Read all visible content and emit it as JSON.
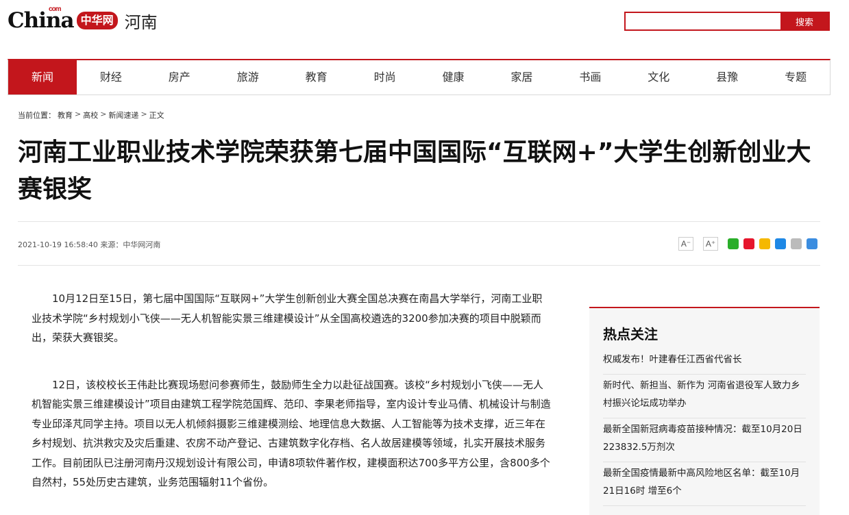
{
  "header": {
    "logo_text": "China",
    "logo_com": "com",
    "logo_zh": "中华网",
    "region": "河南",
    "search_placeholder": "",
    "search_button": "搜索"
  },
  "nav": [
    "新闻",
    "财经",
    "房产",
    "旅游",
    "教育",
    "时尚",
    "健康",
    "家居",
    "书画",
    "文化",
    "县豫",
    "专题"
  ],
  "breadcrumb": {
    "prefix": "当前位置：",
    "items": [
      "教育",
      "高校",
      "新闻速递",
      "正文"
    ],
    "separator": ">"
  },
  "article": {
    "title": "河南工业职业技术学院荣获第七届中国国际“互联网+”大学生创新创业大赛银奖",
    "meta": "2021-10-19 16:58:40 来源：中华网河南",
    "paragraphs": [
      "10月12日至15日，第七届中国国际“互联网+”大学生创新创业大赛全国总决赛在南昌大学举行，河南工业职业技术学院“乡村规划小飞侠——无人机智能实景三维建模设计”从全国高校遴选的3200参加决赛的项目中脱颖而出，荣获大赛银奖。",
      "12日，该校校长王伟赴比赛现场慰问参赛师生，鼓励师生全力以赴征战国赛。该校“乡村规划小飞侠——无人机智能实景三维建模设计”项目由建筑工程学院范国辉、范印、李果老师指导，室内设计专业马倩、机械设计与制造专业邱泽芃同学主持。项目以无人机倾斜摄影三维建模测绘、地理信息大数据、人工智能等为技术支撑，近三年在乡村规划、抗洪救灾及灾后重建、农房不动产登记、古建筑数字化存档、名人故居建模等领域，扎实开展技术服务工作。目前团队已注册河南丹汉规划设计有限公司，申请8项软件著作权，建模面积达700多平方公里，含800多个自然村，55处历史古建筑，业务范围辐射11个省份。"
    ]
  },
  "tools": {
    "font_smaller": "A⁻",
    "font_larger": "A⁺",
    "share_icons": [
      {
        "name": "wechat-icon",
        "color": "#2aae2a"
      },
      {
        "name": "weibo-icon",
        "color": "#e6162d"
      },
      {
        "name": "qzone-icon",
        "color": "#f5b800"
      },
      {
        "name": "qq-icon",
        "color": "#1e88e5"
      },
      {
        "name": "copy-icon",
        "color": "#bbbbbb"
      },
      {
        "name": "print-icon",
        "color": "#3b8de0"
      }
    ]
  },
  "sidebar": {
    "title": "热点关注",
    "items": [
      "权威发布！叶建春任江西省代省长",
      "新时代、新担当、新作为 河南省退役军人致力乡村振兴论坛成功举办",
      "最新全国新冠病毒疫苗接种情况：截至10月20日 223832.5万剂次",
      "最新全国疫情最新中高风险地区名单：截至10月21日16时 增至6个"
    ]
  },
  "colors": {
    "accent": "#c3161c"
  }
}
